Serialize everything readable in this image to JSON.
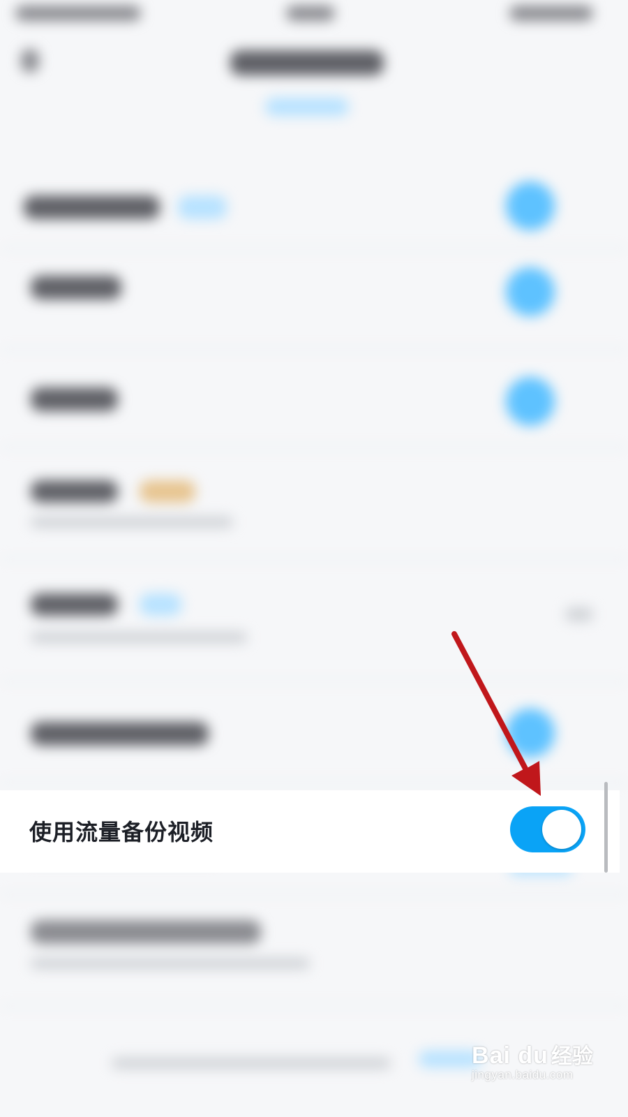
{
  "setting": {
    "label": "使用流量备份视频",
    "enabled": true,
    "accent_color": "#0aa3f6"
  },
  "annotation": {
    "icon": "red-arrow-icon",
    "color": "#c0171b"
  },
  "watermark": {
    "brand": "Bai du",
    "suffix": "经验",
    "url": "jingyan.baidu.com"
  }
}
